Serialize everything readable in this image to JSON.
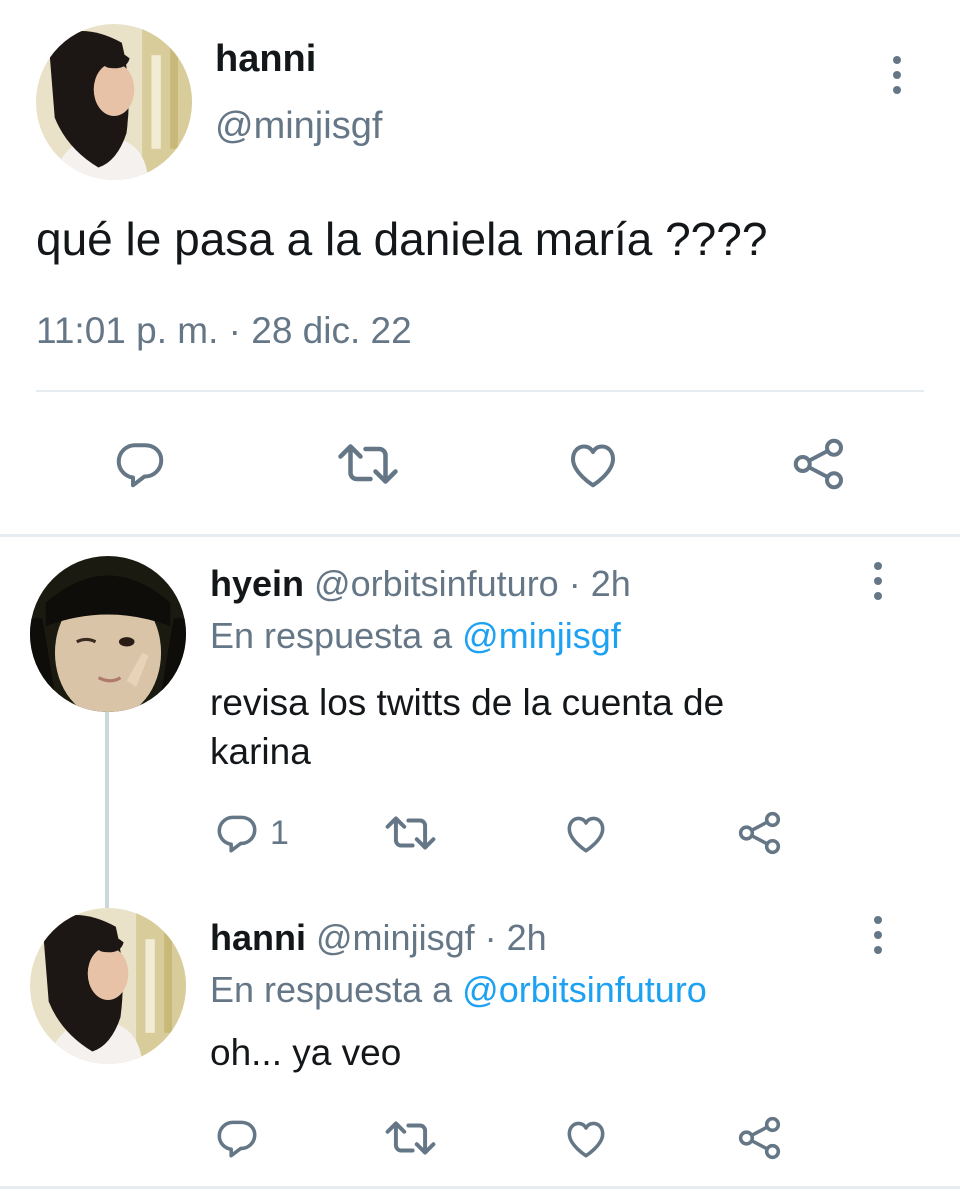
{
  "main_tweet": {
    "display_name": "hanni",
    "handle": "@minjisgf",
    "text": "qué le pasa a la daniela maría ????",
    "timestamp": "11:01 p. m. · 28 dic. 22",
    "actions": {
      "reply_icon": "reply-icon",
      "retweet_icon": "retweet-icon",
      "like_icon": "heart-icon",
      "share_icon": "share-icon"
    }
  },
  "replies": [
    {
      "display_name": "hyein",
      "handle": "@orbitsinfuturo",
      "time": "· 2h",
      "reply_prefix": "En respuesta a",
      "reply_to": "@minjisgf",
      "text": "revisa los twitts de la cuenta de karina",
      "reply_count": "1"
    },
    {
      "display_name": "hanni",
      "handle": "@minjisgf",
      "time": "· 2h",
      "reply_prefix": "En respuesta a",
      "reply_to": "@orbitsinfuturo",
      "text": "oh... ya veo",
      "reply_count": ""
    }
  ],
  "colors": {
    "muted": "#657786",
    "link": "#1da1f2",
    "divider": "#e6ecf0",
    "text": "#14171a"
  }
}
